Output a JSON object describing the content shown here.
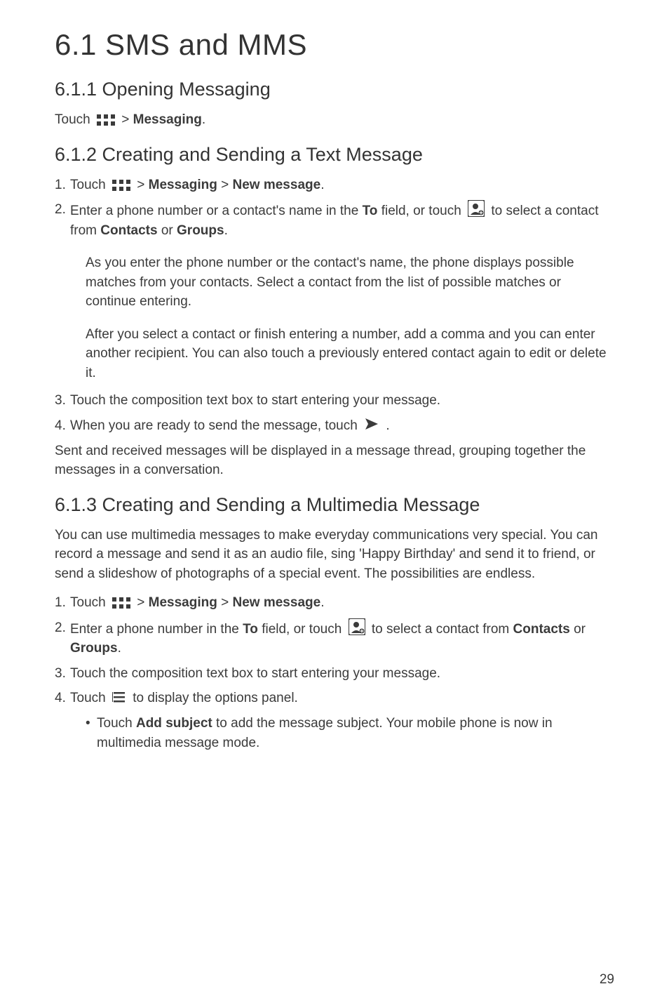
{
  "title": "6.1  SMS and MMS",
  "s611": {
    "heading": "6.1.1  Opening Messaging",
    "line1_a": "Touch ",
    "line1_b": " > ",
    "line1_c": "Messaging",
    "line1_d": "."
  },
  "s612": {
    "heading": "6.1.2  Creating and Sending a Text Message",
    "step1_num": "1. ",
    "step1_a": "Touch ",
    "step1_b": " > ",
    "step1_c": "Messaging",
    "step1_d": " > ",
    "step1_e": "New message",
    "step1_f": ".",
    "step2_num": "2. ",
    "step2_a": "Enter a phone number or a contact's name in the ",
    "step2_b": "To",
    "step2_c": " field, or touch ",
    "step2_d": " to select a contact from ",
    "step2_e": "Contacts",
    "step2_f": " or ",
    "step2_g": "Groups",
    "step2_h": ".",
    "note1": "As you enter the phone number or the contact's name, the phone displays possible matches from your contacts. Select a contact from the list of possible matches or continue entering.",
    "note2": "After you select a contact or finish entering a number, add a comma and you can enter another recipient. You can also touch a previously entered contact again to edit or delete it.",
    "step3_num": "3. ",
    "step3": "Touch the composition text box to start entering your message.",
    "step4_num": "4. ",
    "step4_a": "When you are ready to send the message, touch ",
    "step4_b": " .",
    "after": "Sent and received messages will be displayed in a message thread, grouping together the messages in a conversation."
  },
  "s613": {
    "heading": "6.1.3  Creating and Sending a Multimedia Message",
    "intro": "You can use multimedia messages to make everyday communications very special. You can record a message and send it as an audio file, sing 'Happy Birthday' and send it to friend, or send a slideshow of photographs of a special event. The possibilities are endless.",
    "step1_num": "1. ",
    "step1_a": "Touch ",
    "step1_b": " > ",
    "step1_c": "Messaging",
    "step1_d": " > ",
    "step1_e": "New message",
    "step1_f": ".",
    "step2_num": "2. ",
    "step2_a": "Enter a phone number in the ",
    "step2_b": "To",
    "step2_c": " field, or touch ",
    "step2_d": " to select a contact from ",
    "step2_e": "Contacts",
    "step2_f": " or ",
    "step2_g": "Groups",
    "step2_h": ".",
    "step3_num": "3. ",
    "step3": "Touch the composition text box to start entering your message.",
    "step4_num": "4. ",
    "step4_a": "Touch ",
    "step4_b": " to display the options panel.",
    "bullet_dot": "• ",
    "bullet_a": "Touch ",
    "bullet_b": "Add subject",
    "bullet_c": " to add the message subject. Your mobile phone is now in multimedia message mode."
  },
  "pagenum": "29"
}
